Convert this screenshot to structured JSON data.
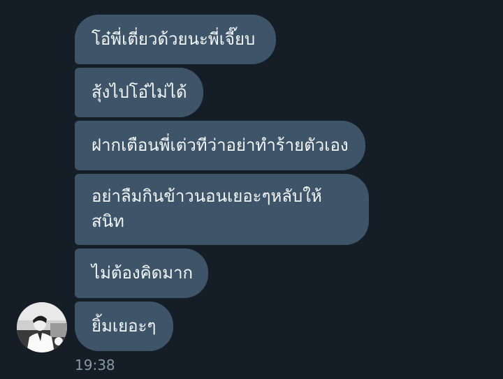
{
  "messages": [
    {
      "text": "โอ๋พี่เตี่ยวด้วยนะพี่เจี๊ยบ"
    },
    {
      "text": "สุ้งไปโอ๋ไม่ได้"
    },
    {
      "text": "ฝากเตือนพี่เต่วทีว่าอย่าทำร้ายตัวเอง"
    },
    {
      "text": "อย่าลืมกินข้าวนอนเยอะๆหลับให้สนิท"
    },
    {
      "text": "ไม่ต้องคิดมาก"
    },
    {
      "text": "ยิ้มเยอะๆ"
    }
  ],
  "timestamp": "19:38",
  "colors": {
    "background": "#151d26",
    "bubble": "#3e5469",
    "bubble_text": "#f3f6f8",
    "timestamp_text": "#8899a6"
  },
  "icons": {
    "avatar": "user-avatar-photo"
  }
}
